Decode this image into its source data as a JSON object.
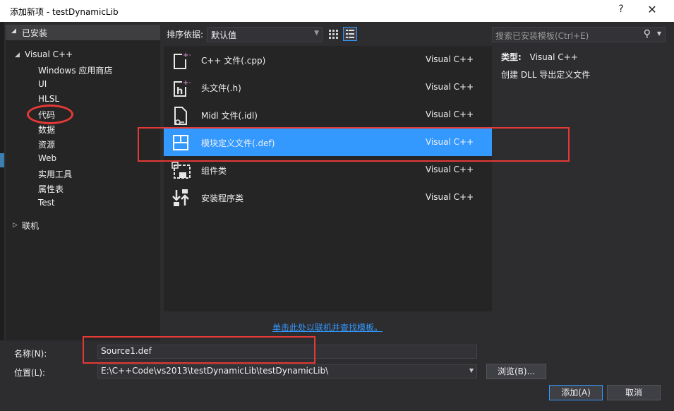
{
  "window": {
    "title": "添加新项 - testDynamicLib",
    "help": "?",
    "close": "✕"
  },
  "left": {
    "header": "已安装",
    "root": "Visual C++",
    "children": [
      "Windows 应用商店",
      "UI",
      "HLSL",
      "代码",
      "数据",
      "资源",
      "Web",
      "实用工具",
      "属性表",
      "Test"
    ],
    "online": "联机"
  },
  "toolbar": {
    "sort_label": "排序依据:",
    "sort_value": "默认值"
  },
  "search": {
    "placeholder": "搜索已安装模板(Ctrl+E)"
  },
  "templates": [
    {
      "name": "C++ 文件(.cpp)",
      "lang": "Visual C++",
      "icon": "cpp-file-icon"
    },
    {
      "name": "头文件(.h)",
      "lang": "Visual C++",
      "icon": "header-file-icon"
    },
    {
      "name": "Midl 文件(.idl)",
      "lang": "Visual C++",
      "icon": "idl-file-icon"
    },
    {
      "name": "模块定义文件(.def)",
      "lang": "Visual C++",
      "icon": "def-file-icon"
    },
    {
      "name": "组件类",
      "lang": "Visual C++",
      "icon": "component-class-icon"
    },
    {
      "name": "安装程序类",
      "lang": "Visual C++",
      "icon": "installer-class-icon"
    }
  ],
  "details": {
    "type_label": "类型:",
    "type_value": "Visual C++",
    "description": "创建 DLL 导出定义文件"
  },
  "online_link": "单击此处以联机并查找模板。",
  "form": {
    "name_label": "名称(N):",
    "name_value": "Source1.def",
    "location_label": "位置(L):",
    "location_value": "E:\\C++Code\\vs2013\\testDynamicLib\\testDynamicLib\\",
    "browse_label": "浏览(B)...",
    "add_label": "添加(A)",
    "cancel_label": "取消"
  },
  "colors": {
    "accent": "#3399ff",
    "annotation": "#e53935",
    "background": "#2d2d30"
  }
}
